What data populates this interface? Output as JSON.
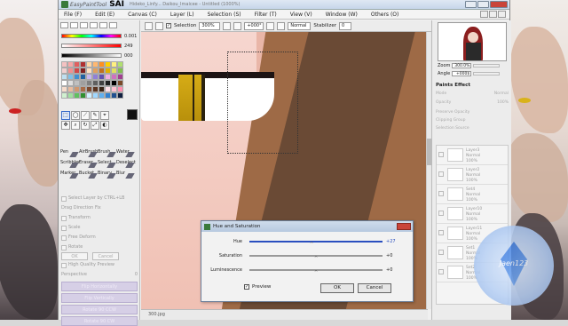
{
  "app": {
    "brand": "EasyPaintTool",
    "name": "SAI",
    "title": "Hideko_Linfy... Daikou_Imaicee - Untitled (1000%)"
  },
  "menu": [
    "File (F)",
    "Edit (E)",
    "Canvas (C)",
    "Layer (L)",
    "Selection (S)",
    "Filter (T)",
    "View (V)",
    "Window (W)",
    "Others (O)"
  ],
  "toolbar": {
    "selection_label": "Selection",
    "zoom": "300%",
    "angle": "+000°",
    "blend": "Normal",
    "stabilizer_label": "Stabilizer",
    "stabilizer": "0"
  },
  "color_panel": {
    "values": [
      "0.001",
      "249",
      "000"
    ]
  },
  "swatches": [
    "#f4c2c2",
    "#f7a8a8",
    "#e06060",
    "#b03030",
    "#ffd8a8",
    "#ffb870",
    "#ff9020",
    "#ffd000",
    "#fff080",
    "#b0e070",
    "#f0d0d0",
    "#f09090",
    "#d04848",
    "#802020",
    "#ffe0c0",
    "#e0a060",
    "#c07020",
    "#e0b000",
    "#e0e060",
    "#80c050",
    "#c0e0f0",
    "#80c0e8",
    "#4090d0",
    "#2060a0",
    "#c8b8f0",
    "#9080d8",
    "#6050b0",
    "#f0b0e0",
    "#d070c0",
    "#a04090",
    "#ffffff",
    "#e0e0e0",
    "#c0c0c0",
    "#a0a0a0",
    "#808080",
    "#606060",
    "#404040",
    "#202020",
    "#000000",
    "#7a4a2a",
    "#f6dccc",
    "#e8bca0",
    "#d09870",
    "#a86c48",
    "#7c4a30",
    "#5a3420",
    "#3a2416",
    "#ffe0e8",
    "#ffc0d0",
    "#ff90b0",
    "#d0f0d0",
    "#a0e0a0",
    "#60c060",
    "#309030",
    "#d0f0ff",
    "#a0d8ff",
    "#60b0f0",
    "#3080d0",
    "#205090",
    "#102040"
  ],
  "tools": [
    "⬚",
    "◯",
    "⟋",
    "✎",
    "⌖",
    "✥",
    "⌕",
    "↻",
    "⤢",
    "◐"
  ],
  "brushes": [
    {
      "name": "Pen"
    },
    {
      "name": "AirBrush"
    },
    {
      "name": "Brush"
    },
    {
      "name": "Water"
    },
    {
      "name": "Scribbler"
    },
    {
      "name": "Eraser"
    },
    {
      "name": "Select"
    },
    {
      "name": "Deselect"
    },
    {
      "name": "Marker"
    },
    {
      "name": "Bucket"
    },
    {
      "name": "Binary"
    },
    {
      "name": "Blur"
    }
  ],
  "left_options": {
    "select_layer": "Select Layer by CTRL+LB",
    "lasso_direction": "Drag Direction Fix",
    "transform": "Transform",
    "scale": "Scale",
    "free_deform": "Free Deform",
    "rotate": "Rotate",
    "ok": "OK",
    "cancel": "Cancel",
    "high_quality": "High Quality Preview",
    "perspective_label": "Perspective",
    "perspective_value": "0",
    "buttons": [
      "Flip Horizontally",
      "Flip Vertically",
      "Rotate 90 CCW",
      "Rotate 90 CW"
    ]
  },
  "navigator": {
    "zoom_label": "Zoom",
    "zoom": "300.0%",
    "angle_label": "Angle",
    "angle": "+000$"
  },
  "layers_panel": {
    "paints_effect": "Paints Effect",
    "mode_label": "Mode",
    "mode": "Normal",
    "opacity_label": "Opacity",
    "opacity": "100%",
    "preserve_opacity": "Preserve Opacity",
    "clipping_group": "Clipping Group",
    "selection_source": "Selection Source",
    "layers": [
      {
        "name": "Layer3",
        "mode": "Normal",
        "opacity": "100%"
      },
      {
        "name": "Layer2",
        "mode": "Normal",
        "opacity": "100%"
      },
      {
        "name": "Set4",
        "mode": "Normal",
        "opacity": "100%"
      },
      {
        "name": "Layer10",
        "mode": "Normal",
        "opacity": "100%"
      },
      {
        "name": "Layer11",
        "mode": "Normal",
        "opacity": "100%"
      },
      {
        "name": "Set1",
        "mode": "Normal",
        "opacity": "100%"
      },
      {
        "name": "Set2",
        "mode": "Normal",
        "opacity": "100%"
      }
    ]
  },
  "status": "300.jpg",
  "dialog": {
    "title": "Hue and Saturation",
    "rows": [
      {
        "label": "Hue",
        "value": "+27"
      },
      {
        "label": "Saturation",
        "value": "+0"
      },
      {
        "label": "Luminescence",
        "value": "+0"
      }
    ],
    "preview_label": "Preview",
    "ok": "OK",
    "cancel": "Cancel"
  },
  "watermark": "Jaen123",
  "colors": {
    "accent": "#2a4fbf",
    "title_bar": "#c6d6ea",
    "close_button": "#c9453a"
  }
}
